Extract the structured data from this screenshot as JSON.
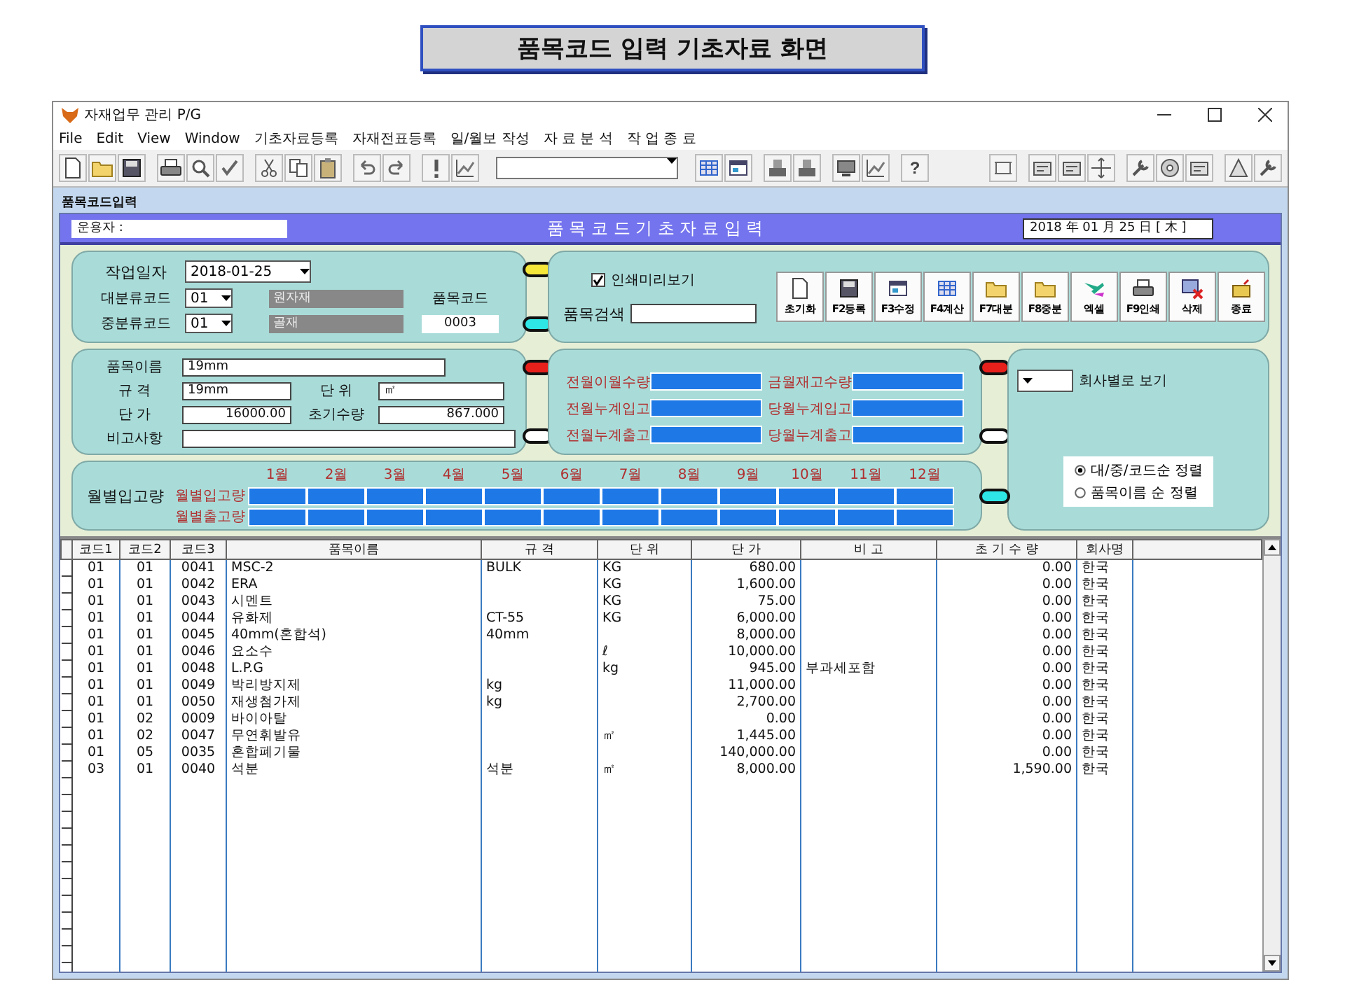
{
  "banner": {
    "title": "품목코드 입력 기초자료 화면"
  },
  "window": {
    "title": "자재업무 관리 P/G"
  },
  "menu": [
    "File",
    "Edit",
    "View",
    "Window",
    "기초자료등록",
    "자재전표등록",
    "일/월보 작성",
    "자 료 분 석",
    "작 업 종 료"
  ],
  "toolbar": {
    "help": "?"
  },
  "child_window": {
    "title": "품목코드입력"
  },
  "header": {
    "operator_label": "운용자 :",
    "title": "품 목 코 드 기 초 자 료 입 력",
    "date": "2018 年 01 月 25 日 [ 木 ]"
  },
  "work": {
    "date_label": "작업일자",
    "date": "2018-01-25",
    "major_label": "대분류코드",
    "major_code": "01",
    "major_name": "원자재",
    "minor_label": "중분류코드",
    "minor_code": "01",
    "minor_name": "골재",
    "item_code_label": "품목코드",
    "item_code": "0003"
  },
  "search": {
    "preview_label": "인쇄미리보기",
    "preview_checked": true,
    "search_label": "품목검색"
  },
  "actions": [
    {
      "label": "초기화",
      "kind": "page"
    },
    {
      "label": "F2등록",
      "kind": "disk"
    },
    {
      "label": "F3수정",
      "kind": "window"
    },
    {
      "label": "F4계산",
      "kind": "grid"
    },
    {
      "label": "F7대분",
      "kind": "folder"
    },
    {
      "label": "F8중분",
      "kind": "folder"
    },
    {
      "label": "엑셀",
      "kind": "brushes"
    },
    {
      "label": "F9인쇄",
      "kind": "printer"
    },
    {
      "label": "삭제",
      "kind": "delete"
    },
    {
      "label": "종료",
      "kind": "box"
    }
  ],
  "item": {
    "name_label": "품목이름",
    "name": "19mm",
    "spec_label": "규 격",
    "spec": "19mm",
    "unit_label": "단 위",
    "unit": "㎡",
    "price_label": "단 가",
    "price": "16000.00",
    "initial_qty_label": "초기수량",
    "initial_qty": "867.000",
    "note_label": "비고사항"
  },
  "prev_month": [
    "전월이월수량",
    "전월누계입고",
    "전월누계출고"
  ],
  "this_month": [
    "금월재고수량",
    "당월누계입고",
    "당월누계출고"
  ],
  "company": {
    "label": "회사별로 보기"
  },
  "sort": [
    {
      "label": "대/중/코드순 정렬",
      "selected": true
    },
    {
      "label": "품목이름 순 정렬",
      "selected": false
    }
  ],
  "monthly": {
    "label": "월별입고량",
    "in_label": "월별입고량",
    "out_label": "월별출고량",
    "months": [
      "1월",
      "2월",
      "3월",
      "4월",
      "5월",
      "6월",
      "7월",
      "8월",
      "9월",
      "10월",
      "11월",
      "12월"
    ]
  },
  "table": {
    "columns": [
      "코드1",
      "코드2",
      "코드3",
      "품목이름",
      "규 격",
      "단 위",
      "단 가",
      "비 고",
      "초 기 수 량",
      "회사명"
    ],
    "rows": [
      {
        "code1": "01",
        "code2": "01",
        "code3": "0041",
        "name": "MSC-2",
        "spec": "BULK",
        "unit": "KG",
        "price": "680.00",
        "initial_qty": "0.00",
        "company": "한국"
      },
      {
        "code1": "01",
        "code2": "01",
        "code3": "0042",
        "name": "ERA",
        "unit": "KG",
        "price": "1,600.00",
        "initial_qty": "0.00",
        "company": "한국"
      },
      {
        "code1": "01",
        "code2": "01",
        "code3": "0043",
        "name": "시멘트",
        "unit": "KG",
        "price": "75.00",
        "initial_qty": "0.00",
        "company": "한국"
      },
      {
        "code1": "01",
        "code2": "01",
        "code3": "0044",
        "name": "유화제",
        "spec": "CT-55",
        "unit": "KG",
        "price": "6,000.00",
        "initial_qty": "0.00",
        "company": "한국"
      },
      {
        "code1": "01",
        "code2": "01",
        "code3": "0045",
        "name": "40mm(혼합석)",
        "spec": "40mm",
        "price": "8,000.00",
        "initial_qty": "0.00",
        "company": "한국"
      },
      {
        "code1": "01",
        "code2": "01",
        "code3": "0046",
        "name": "요소수",
        "unit": "ℓ",
        "price": "10,000.00",
        "initial_qty": "0.00",
        "company": "한국"
      },
      {
        "code1": "01",
        "code2": "01",
        "code3": "0048",
        "name": "L.P.G",
        "unit": "kg",
        "price": "945.00",
        "note": "부과세포함",
        "initial_qty": "0.00",
        "company": "한국"
      },
      {
        "code1": "01",
        "code2": "01",
        "code3": "0049",
        "name": "박리방지제",
        "spec": "kg",
        "price": "11,000.00",
        "initial_qty": "0.00",
        "company": "한국"
      },
      {
        "code1": "01",
        "code2": "01",
        "code3": "0050",
        "name": "재생첨가제",
        "spec": "kg",
        "price": "2,700.00",
        "initial_qty": "0.00",
        "company": "한국"
      },
      {
        "code1": "01",
        "code2": "02",
        "code3": "0009",
        "name": "바이아탈",
        "price": "0.00",
        "initial_qty": "0.00",
        "company": "한국"
      },
      {
        "code1": "01",
        "code2": "02",
        "code3": "0047",
        "name": "무연휘발유",
        "unit": "㎡",
        "price": "1,445.00",
        "initial_qty": "0.00",
        "company": "한국"
      },
      {
        "code1": "01",
        "code2": "05",
        "code3": "0035",
        "name": "혼합폐기물",
        "price": "140,000.00",
        "initial_qty": "0.00",
        "company": "한국"
      },
      {
        "code1": "03",
        "code2": "01",
        "code3": "0040",
        "name": "석분",
        "spec": "석분",
        "unit": "㎡",
        "price": "8,000.00",
        "initial_qty": "1,590.00",
        "company": "한국"
      }
    ]
  }
}
